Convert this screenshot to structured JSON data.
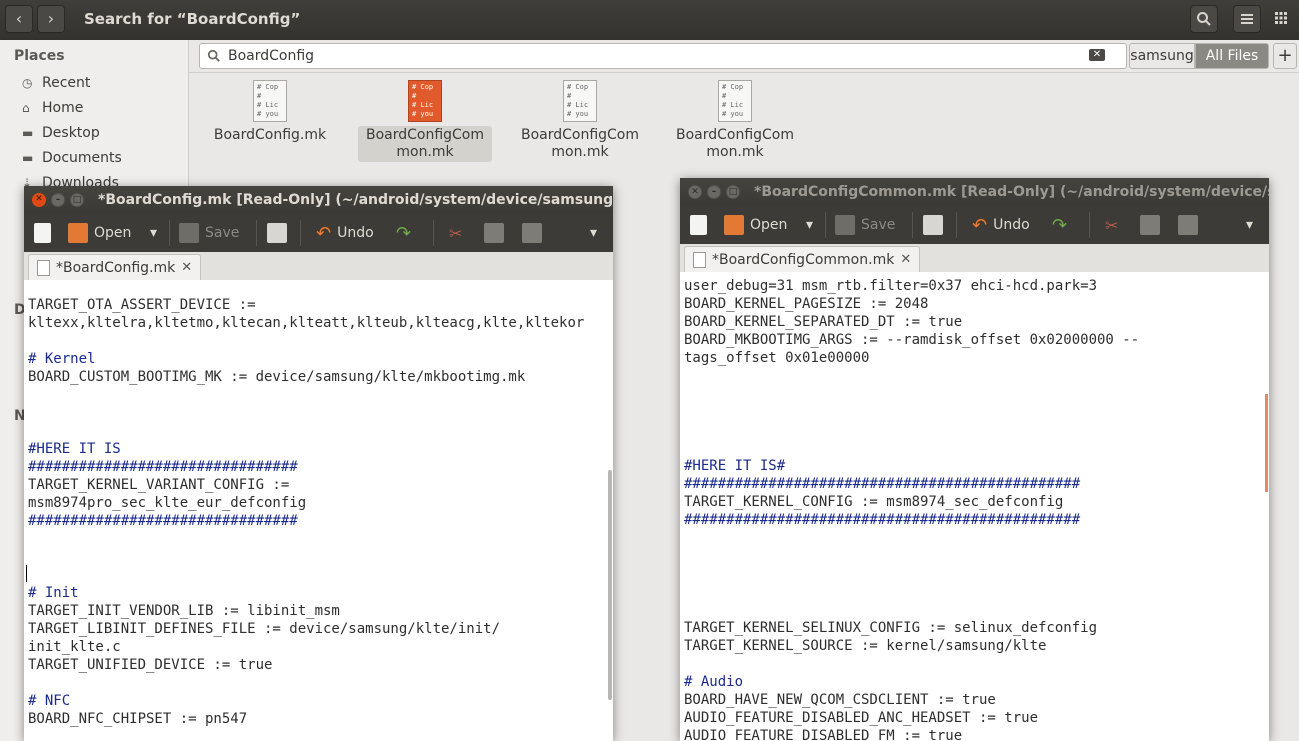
{
  "header": {
    "title": "Search for “BoardConfig”",
    "back_glyph": "‹",
    "forward_glyph": "›"
  },
  "sidebar": {
    "heading": "Places",
    "items": [
      {
        "label": "Recent",
        "icon": "clock-icon"
      },
      {
        "label": "Home",
        "icon": "home-icon"
      },
      {
        "label": "Desktop",
        "icon": "folder-icon"
      },
      {
        "label": "Documents",
        "icon": "folder-icon"
      },
      {
        "label": "Downloads",
        "icon": "download-icon"
      }
    ],
    "partial_letters": [
      "D",
      "N"
    ]
  },
  "search": {
    "value": "BoardConfig",
    "location_button": "samsung",
    "files_button": "All Files",
    "add_glyph": "+"
  },
  "files": [
    {
      "name": "BoardConfig.mk",
      "selected": false
    },
    {
      "name": "BoardConfigCommon.mk",
      "selected": true
    },
    {
      "name": "BoardConfigCommon.mk",
      "selected": false
    },
    {
      "name": "BoardConfigCommon.mk",
      "selected": false
    }
  ],
  "file_thumb_text": [
    "# Cop",
    "#",
    "# Lic",
    "# you"
  ],
  "window_left": {
    "title": "*BoardConfig.mk [Read-Only] (~/android/system/device/samsung/klte)",
    "tab": "*BoardConfig.mk",
    "lines": [
      {
        "text": "TARGET_OTA_ASSERT_DEVICE :=",
        "comment": false
      },
      {
        "text": "kltexx,kltelra,kltetmo,kltecan,klteatt,klteub,klteacg,klte,kltekor",
        "comment": false
      },
      {
        "text": "",
        "comment": false
      },
      {
        "text": "# Kernel",
        "comment": true
      },
      {
        "text": "BOARD_CUSTOM_BOOTIMG_MK := device/samsung/klte/mkbootimg.mk",
        "comment": false
      },
      {
        "text": "",
        "comment": false
      },
      {
        "text": "",
        "comment": false
      },
      {
        "text": "",
        "comment": false
      },
      {
        "text": "#HERE IT IS",
        "comment": true
      },
      {
        "text": "################################",
        "comment": true
      },
      {
        "text": "TARGET_KERNEL_VARIANT_CONFIG :=",
        "comment": false
      },
      {
        "text": "msm8974pro_sec_klte_eur_defconfig",
        "comment": false
      },
      {
        "text": "################################",
        "comment": true
      },
      {
        "text": "",
        "comment": false
      },
      {
        "text": "",
        "comment": false
      },
      {
        "text": "",
        "comment": false
      },
      {
        "text": "# Init",
        "comment": true
      },
      {
        "text": "TARGET_INIT_VENDOR_LIB := libinit_msm",
        "comment": false
      },
      {
        "text": "TARGET_LIBINIT_DEFINES_FILE := device/samsung/klte/init/",
        "comment": false
      },
      {
        "text": "init_klte.c",
        "comment": false
      },
      {
        "text": "TARGET_UNIFIED_DEVICE := true",
        "comment": false
      },
      {
        "text": "",
        "comment": false
      },
      {
        "text": "# NFC",
        "comment": true
      },
      {
        "text": "BOARD_NFC_CHIPSET := pn547",
        "comment": false
      }
    ]
  },
  "window_right": {
    "title": "*BoardConfigCommon.mk [Read-Only] (~/android/system/device/samsung",
    "tab": "*BoardConfigCommon.mk",
    "lines": [
      {
        "text": "user_debug=31 msm_rtb.filter=0x37 ehci-hcd.park=3",
        "comment": false
      },
      {
        "text": "BOARD_KERNEL_PAGESIZE := 2048",
        "comment": false
      },
      {
        "text": "BOARD_KERNEL_SEPARATED_DT := true",
        "comment": false
      },
      {
        "text": "BOARD_MKBOOTIMG_ARGS := --ramdisk_offset 0x02000000 --",
        "comment": false
      },
      {
        "text": "tags_offset 0x01e00000",
        "comment": false
      },
      {
        "text": "",
        "comment": false
      },
      {
        "text": "",
        "comment": false
      },
      {
        "text": "",
        "comment": false
      },
      {
        "text": "",
        "comment": false
      },
      {
        "text": "",
        "comment": false
      },
      {
        "text": "#HERE IT IS#",
        "comment": true
      },
      {
        "text": "###############################################",
        "comment": true
      },
      {
        "text": "TARGET_KERNEL_CONFIG := msm8974_sec_defconfig",
        "comment": false
      },
      {
        "text": "###############################################",
        "comment": true
      },
      {
        "text": "",
        "comment": false
      },
      {
        "text": "",
        "comment": false
      },
      {
        "text": "",
        "comment": false
      },
      {
        "text": "",
        "comment": false
      },
      {
        "text": "",
        "comment": false
      },
      {
        "text": "",
        "comment": false
      },
      {
        "text": "TARGET_KERNEL_SELINUX_CONFIG := selinux_defconfig",
        "comment": false
      },
      {
        "text": "TARGET_KERNEL_SOURCE := kernel/samsung/klte",
        "comment": false
      },
      {
        "text": "",
        "comment": false
      },
      {
        "text": "# Audio",
        "comment": true
      },
      {
        "text": "BOARD_HAVE_NEW_QCOM_CSDCLIENT := true",
        "comment": false
      },
      {
        "text": "AUDIO_FEATURE_DISABLED_ANC_HEADSET := true",
        "comment": false
      },
      {
        "text": "AUDIO_FEATURE_DISABLED_FM := true",
        "comment": false
      }
    ]
  },
  "toolbar": {
    "open_label": "Open",
    "save_label": "Save",
    "undo_label": "Undo",
    "dropdown_glyph": "▾"
  },
  "colors": {
    "accent_orange": "#df4a16",
    "comment_blue": "#1a2a8c",
    "header_dark": "#3c3b37"
  }
}
